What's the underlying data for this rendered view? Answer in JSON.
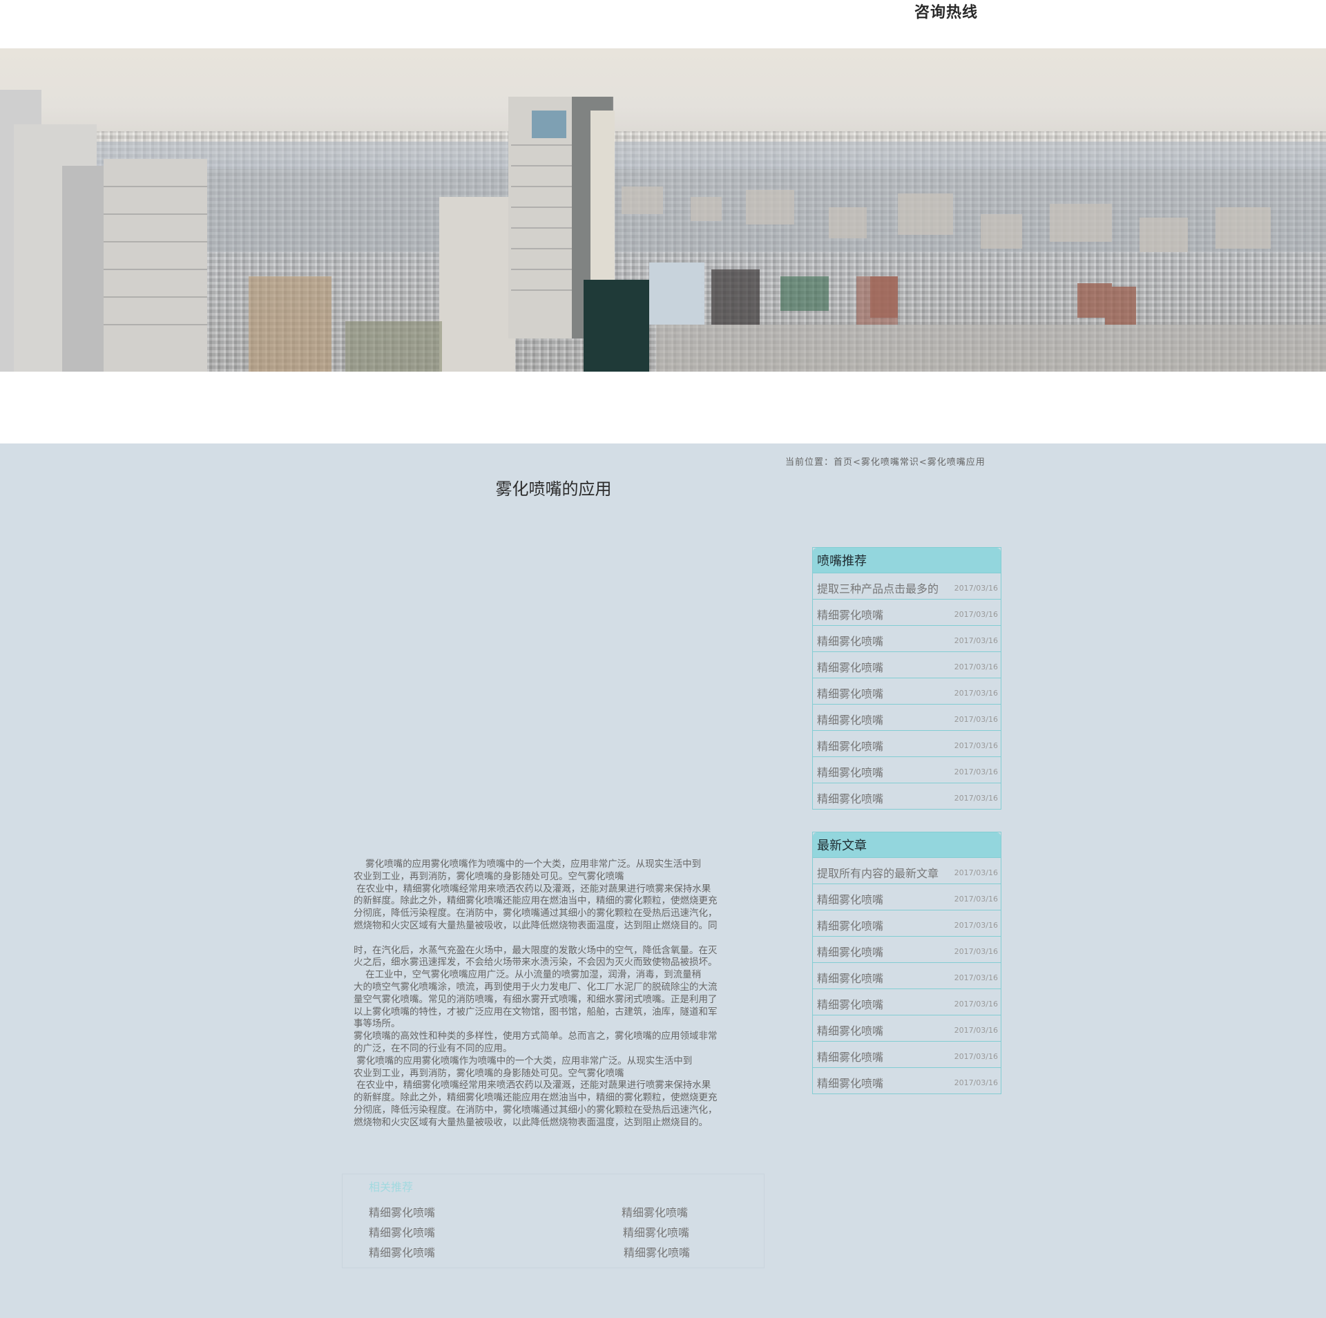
{
  "header": {
    "hotline": "咨询热线"
  },
  "breadcrumb": "当前位置：首页<雾化喷嘴常识<雾化喷嘴应用",
  "article": {
    "title": "雾化喷嘴的应用",
    "paragraphs": [
      "    雾化喷嘴的应用雾化喷嘴作为喷嘴中的一个大类，应用非常广泛。从现实生活中到\n农业到工业，再到消防，雾化喷嘴的身影随处可见。空气雾化喷嘴\n 在农业中，精细雾化喷嘴经常用来喷洒农药以及灌溉，还能对蔬果进行喷雾来保持水果\n的新鲜度。除此之外，精细雾化喷嘴还能应用在燃油当中，精细的雾化颗粒，使燃烧更充\n分彻底，降低污染程度。在消防中，雾化喷嘴通过其细小的雾化颗粒在受热后迅速汽化，\n燃烧物和火灾区域有大量热量被吸收，以此降低燃烧物表面温度，达到阻止燃烧目的。同\n\n时，在汽化后，水蒸气充盈在火场中，最大限度的发散火场中的空气，降低含氧量。在灭\n火之后，细水雾迅速挥发，不会给火场带来水渍污染，不会因为灭火而致使物品被损坏。\n    在工业中，空气雾化喷嘴应用广泛。从小流量的喷雾加湿，润滑，消毒，到流量稍\n大的喷空气雾化喷嘴涂，喷流，再到使用于火力发电厂、化工厂水泥厂的脱硫除尘的大流\n量空气雾化喷嘴。常见的消防喷嘴，有细水雾开式喷嘴，和细水雾闭式喷嘴。正是利用了\n以上雾化喷嘴的特性，才被广泛应用在文物馆，图书馆，船舶，古建筑，油库，隧道和军\n事等场所。\n雾化喷嘴的高效性和种类的多样性，使用方式简单。总而言之，雾化喷嘴的应用领域非常\n的广泛，在不同的行业有不同的应用。\n 雾化喷嘴的应用雾化喷嘴作为喷嘴中的一个大类，应用非常广泛。从现实生活中到\n农业到工业，再到消防，雾化喷嘴的身影随处可见。空气雾化喷嘴\n 在农业中，精细雾化喷嘴经常用来喷洒农药以及灌溉，还能对蔬果进行喷雾来保持水果\n的新鲜度。除此之外，精细雾化喷嘴还能应用在燃油当中，精细的雾化颗粒，使燃烧更充\n分彻底，降低污染程度。在消防中，雾化喷嘴通过其细小的雾化颗粒在受热后迅速汽化，\n燃烧物和火灾区域有大量热量被吸收，以此降低燃烧物表面温度，达到阻止燃烧目的。"
    ]
  },
  "sidebar": {
    "recommend": {
      "title": "喷嘴推荐",
      "items": [
        {
          "title": "提取三种产品点击最多的",
          "date": "2017/03/16"
        },
        {
          "title": "精细雾化喷嘴",
          "date": "2017/03/16"
        },
        {
          "title": "精细雾化喷嘴",
          "date": "2017/03/16"
        },
        {
          "title": "精细雾化喷嘴",
          "date": "2017/03/16"
        },
        {
          "title": "精细雾化喷嘴",
          "date": "2017/03/16"
        },
        {
          "title": "精细雾化喷嘴",
          "date": "2017/03/16"
        },
        {
          "title": "精细雾化喷嘴",
          "date": "2017/03/16"
        },
        {
          "title": "精细雾化喷嘴",
          "date": "2017/03/16"
        },
        {
          "title": "精细雾化喷嘴",
          "date": "2017/03/16"
        }
      ]
    },
    "latest": {
      "title": "最新文章",
      "items": [
        {
          "title": "提取所有内容的最新文章",
          "date": "2017/03/16"
        },
        {
          "title": "精细雾化喷嘴",
          "date": "2017/03/16"
        },
        {
          "title": "精细雾化喷嘴",
          "date": "2017/03/16"
        },
        {
          "title": "精细雾化喷嘴",
          "date": "2017/03/16"
        },
        {
          "title": "精细雾化喷嘴",
          "date": "2017/03/16"
        },
        {
          "title": "精细雾化喷嘴",
          "date": "2017/03/16"
        },
        {
          "title": "精细雾化喷嘴",
          "date": "2017/03/16"
        },
        {
          "title": "精细雾化喷嘴",
          "date": "2017/03/16"
        },
        {
          "title": "精细雾化喷嘴",
          "date": "2017/03/16"
        }
      ]
    }
  },
  "related": {
    "title": "相关推荐",
    "items": [
      "精细雾化喷嘴",
      "精细雾化喷嘴",
      "精细雾化喷嘴",
      "精细雾化喷嘴",
      "精细雾化喷嘴",
      "精细雾化喷嘴"
    ]
  }
}
